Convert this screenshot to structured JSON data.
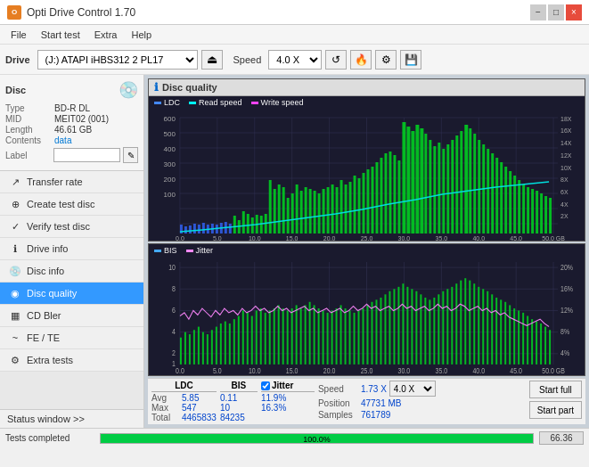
{
  "app": {
    "title": "Opti Drive Control 1.70",
    "icon": "O"
  },
  "titlebar": {
    "minimize": "−",
    "maximize": "□",
    "close": "×"
  },
  "menu": {
    "items": [
      "File",
      "Start test",
      "Extra",
      "Help"
    ]
  },
  "drive_toolbar": {
    "drive_label": "Drive",
    "drive_value": "(J:) ATAPI iHBS312 2 PL17",
    "speed_label": "Speed",
    "speed_value": "4.0 X"
  },
  "disc": {
    "title": "Disc",
    "type_label": "Type",
    "type_value": "BD-R DL",
    "mid_label": "MID",
    "mid_value": "MEIT02 (001)",
    "length_label": "Length",
    "length_value": "46.61 GB",
    "contents_label": "Contents",
    "contents_value": "data",
    "label_label": "Label"
  },
  "nav": {
    "items": [
      {
        "id": "transfer-rate",
        "label": "Transfer rate",
        "icon": "↗"
      },
      {
        "id": "create-test-disc",
        "label": "Create test disc",
        "icon": "⊕"
      },
      {
        "id": "verify-test-disc",
        "label": "Verify test disc",
        "icon": "✓"
      },
      {
        "id": "drive-info",
        "label": "Drive info",
        "icon": "ℹ"
      },
      {
        "id": "disc-info",
        "label": "Disc info",
        "icon": "💿"
      },
      {
        "id": "disc-quality",
        "label": "Disc quality",
        "icon": "◉",
        "active": true
      },
      {
        "id": "cd-bler",
        "label": "CD Bler",
        "icon": "▦"
      },
      {
        "id": "fe-te",
        "label": "FE / TE",
        "icon": "~"
      },
      {
        "id": "extra-tests",
        "label": "Extra tests",
        "icon": "⚙"
      }
    ]
  },
  "status_window": {
    "label": "Status window >>"
  },
  "disc_quality": {
    "panel_title": "Disc quality",
    "legend": {
      "ldc": "LDC",
      "read_speed": "Read speed",
      "write_speed": "Write speed"
    },
    "upper_chart": {
      "y_max": 600,
      "y_right_labels": [
        "18X",
        "16X",
        "14X",
        "12X",
        "10X",
        "8X",
        "6X",
        "4X",
        "2X"
      ],
      "x_labels": [
        "0.0",
        "5.0",
        "10.0",
        "15.0",
        "20.0",
        "25.0",
        "30.0",
        "35.0",
        "40.0",
        "45.0",
        "50.0 GB"
      ]
    },
    "lower_legend": {
      "bis": "BIS",
      "jitter": "Jitter"
    },
    "lower_chart": {
      "y_max": 10,
      "y_right_labels": [
        "20%",
        "16%",
        "12%",
        "8%",
        "4%"
      ],
      "x_labels": [
        "0.0",
        "5.0",
        "10.0",
        "15.0",
        "20.0",
        "25.0",
        "30.0",
        "35.0",
        "40.0",
        "45.0",
        "50.0 GB"
      ]
    }
  },
  "stats": {
    "headers": [
      "LDC",
      "BIS",
      "",
      "Jitter",
      "Speed",
      "",
      ""
    ],
    "avg_label": "Avg",
    "max_label": "Max",
    "total_label": "Total",
    "ldc_avg": "5.85",
    "ldc_max": "547",
    "ldc_total": "4465833",
    "bis_avg": "0.11",
    "bis_max": "10",
    "bis_total": "84235",
    "jitter_avg": "11.9%",
    "jitter_max": "16.3%",
    "jitter_check": true,
    "speed_label": "Speed",
    "speed_value": "1.73 X",
    "speed_select": "4.0 X",
    "position_label": "Position",
    "position_value": "47731 MB",
    "samples_label": "Samples",
    "samples_value": "761789",
    "start_full_btn": "Start full",
    "start_part_btn": "Start part"
  },
  "statusbar": {
    "status_text": "Tests completed",
    "progress": 100,
    "progress_label": "100.0%",
    "right_value": "66.36"
  }
}
